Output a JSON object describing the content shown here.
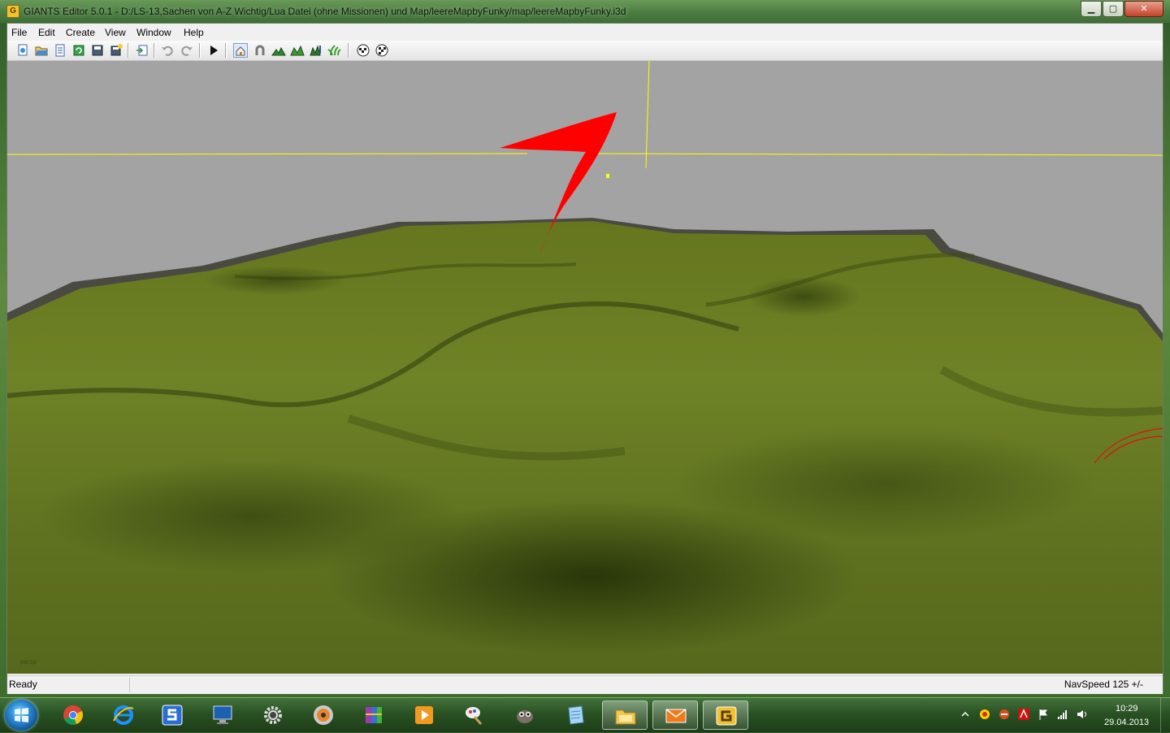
{
  "window": {
    "title": "GIANTS Editor 5.0.1 - D:/LS-13,Sachen von A-Z Wichtig/Lua Datei (ohne Missionen) und Map/leereMapbyFunky/map/leereMapbyFunky.i3d",
    "icon": "giants-editor-icon",
    "controls": [
      "minimize",
      "maximize",
      "close"
    ]
  },
  "menubar": {
    "items": [
      "File",
      "Edit",
      "Create",
      "View",
      "Window",
      "Help"
    ]
  },
  "toolbar": {
    "groups": [
      [
        "new",
        "open",
        "scenegraph",
        "refresh",
        "save",
        "save-as"
      ],
      [
        "import"
      ],
      [
        "undo",
        "redo"
      ],
      [
        "play"
      ],
      [
        "select-mode",
        "magnet",
        "terrain-sculpt",
        "terrain-paint",
        "foliage-paint",
        "foliage-grass"
      ],
      [
        "texture-a",
        "texture-b"
      ]
    ]
  },
  "viewport": {
    "camera_label": "persp",
    "background": "#a3a3a3",
    "terrain_color": "#6b7f24",
    "annotation_arrow_color": "#ff0000",
    "gizmo_color": "#ffff00"
  },
  "statusbar": {
    "status": "Ready",
    "navspeed": "NavSpeed 125 +/-"
  },
  "taskbar": {
    "pinned": [
      "chrome-icon",
      "internet-explorer-icon",
      "app-s-icon",
      "monitor-icon",
      "settings-gear-icon",
      "dvd-icon",
      "winrar-icon",
      "media-player-icon",
      "paint-icon",
      "gimp-icon",
      "notepad-icon",
      "explorer-folder-icon",
      "mail-icon",
      "giants-editor-icon"
    ],
    "open": [
      "explorer-folder-icon",
      "mail-icon",
      "giants-editor-icon"
    ],
    "clock_time": "10:29",
    "clock_date": "29.04.2013"
  }
}
